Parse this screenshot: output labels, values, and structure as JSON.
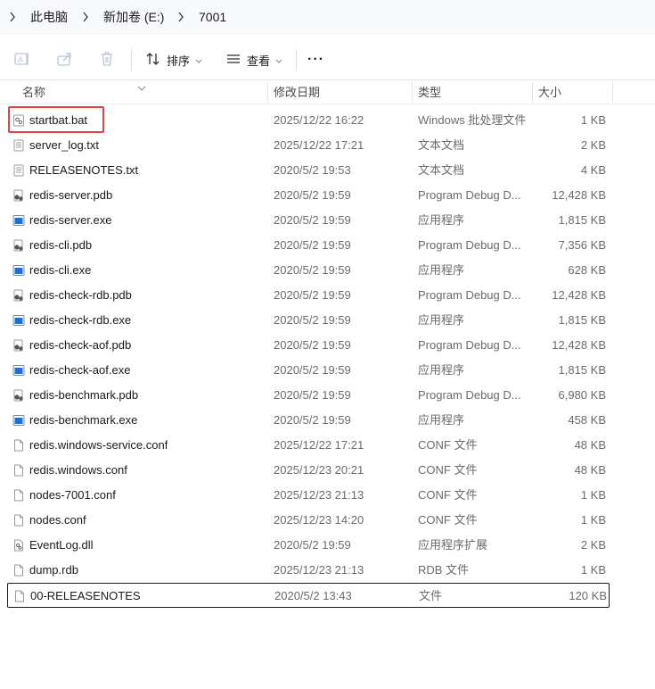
{
  "breadcrumb": [
    "此电脑",
    "新加卷 (E:)",
    "7001"
  ],
  "toolbar": {
    "sort_label": "排序",
    "view_label": "查看",
    "more_label": "···"
  },
  "columns": {
    "name": "名称",
    "date": "修改日期",
    "type": "类型",
    "size": "大小"
  },
  "files": [
    {
      "name": "startbat.bat",
      "date": "2025/12/22 16:22",
      "type": "Windows 批处理文件",
      "size": "1 KB",
      "icon": "batch-icon"
    },
    {
      "name": "server_log.txt",
      "date": "2025/12/22 17:21",
      "type": "文本文档",
      "size": "2 KB",
      "icon": "text-file-icon"
    },
    {
      "name": "RELEASENOTES.txt",
      "date": "2020/5/2 19:53",
      "type": "文本文档",
      "size": "4 KB",
      "icon": "text-file-icon"
    },
    {
      "name": "redis-server.pdb",
      "date": "2020/5/2 19:59",
      "type": "Program Debug D...",
      "size": "12,428 KB",
      "icon": "pdb-file-icon"
    },
    {
      "name": "redis-server.exe",
      "date": "2020/5/2 19:59",
      "type": "应用程序",
      "size": "1,815 KB",
      "icon": "exe-file-icon"
    },
    {
      "name": "redis-cli.pdb",
      "date": "2020/5/2 19:59",
      "type": "Program Debug D...",
      "size": "7,356 KB",
      "icon": "pdb-file-icon"
    },
    {
      "name": "redis-cli.exe",
      "date": "2020/5/2 19:59",
      "type": "应用程序",
      "size": "628 KB",
      "icon": "exe-file-icon"
    },
    {
      "name": "redis-check-rdb.pdb",
      "date": "2020/5/2 19:59",
      "type": "Program Debug D...",
      "size": "12,428 KB",
      "icon": "pdb-file-icon"
    },
    {
      "name": "redis-check-rdb.exe",
      "date": "2020/5/2 19:59",
      "type": "应用程序",
      "size": "1,815 KB",
      "icon": "exe-file-icon"
    },
    {
      "name": "redis-check-aof.pdb",
      "date": "2020/5/2 19:59",
      "type": "Program Debug D...",
      "size": "12,428 KB",
      "icon": "pdb-file-icon"
    },
    {
      "name": "redis-check-aof.exe",
      "date": "2020/5/2 19:59",
      "type": "应用程序",
      "size": "1,815 KB",
      "icon": "exe-file-icon"
    },
    {
      "name": "redis-benchmark.pdb",
      "date": "2020/5/2 19:59",
      "type": "Program Debug D...",
      "size": "6,980 KB",
      "icon": "pdb-file-icon"
    },
    {
      "name": "redis-benchmark.exe",
      "date": "2020/5/2 19:59",
      "type": "应用程序",
      "size": "458 KB",
      "icon": "exe-file-icon"
    },
    {
      "name": "redis.windows-service.conf",
      "date": "2025/12/22 17:21",
      "type": "CONF 文件",
      "size": "48 KB",
      "icon": "blank-file-icon"
    },
    {
      "name": "redis.windows.conf",
      "date": "2025/12/23 20:21",
      "type": "CONF 文件",
      "size": "48 KB",
      "icon": "blank-file-icon"
    },
    {
      "name": "nodes-7001.conf",
      "date": "2025/12/23 21:13",
      "type": "CONF 文件",
      "size": "1 KB",
      "icon": "blank-file-icon"
    },
    {
      "name": "nodes.conf",
      "date": "2025/12/23 14:20",
      "type": "CONF 文件",
      "size": "1 KB",
      "icon": "blank-file-icon"
    },
    {
      "name": "EventLog.dll",
      "date": "2020/5/2 19:59",
      "type": "应用程序扩展",
      "size": "2 KB",
      "icon": "dll-file-icon"
    },
    {
      "name": "dump.rdb",
      "date": "2025/12/23 21:13",
      "type": "RDB 文件",
      "size": "1 KB",
      "icon": "blank-file-icon"
    },
    {
      "name": "00-RELEASENOTES",
      "date": "2020/5/2 13:43",
      "type": "文件",
      "size": "120 KB",
      "icon": "blank-file-icon"
    }
  ],
  "highlighted_file": "startbat.bat",
  "focused_file": "00-RELEASENOTES",
  "colors": {
    "highlight_border": "#e8403d",
    "exe_icon_blue": "#1f6fd1"
  }
}
